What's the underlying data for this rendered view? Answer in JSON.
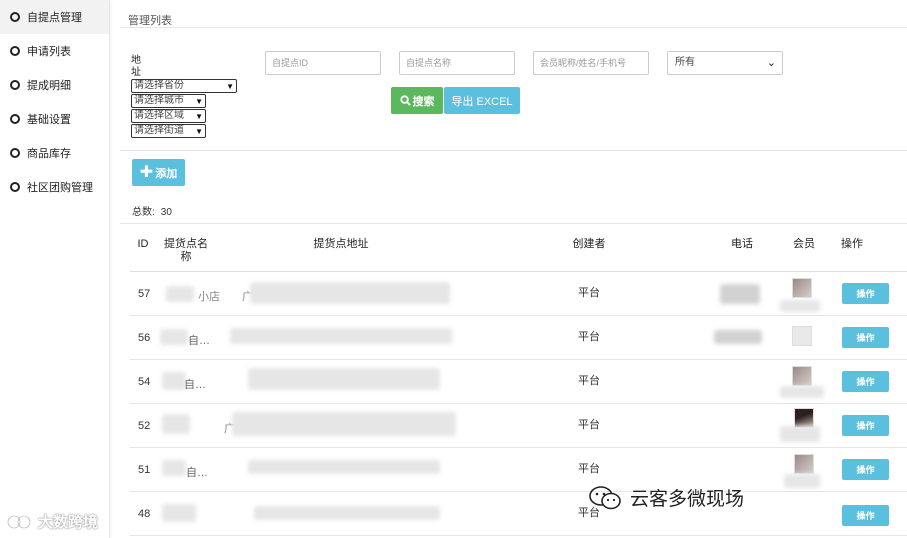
{
  "sidebar": {
    "items": [
      {
        "label": "自提点管理",
        "active": true
      },
      {
        "label": "申请列表"
      },
      {
        "label": "提成明细"
      },
      {
        "label": "基础设置"
      },
      {
        "label": "商品库存"
      },
      {
        "label": "社区团购管理"
      }
    ],
    "watermark": "大数跨境"
  },
  "page": {
    "title": "管理列表"
  },
  "filters": {
    "address_label": "地址",
    "province": "请选择省份",
    "city": "请选择城市",
    "district": "请选择区域",
    "street": "请选择街道",
    "id_placeholder": "自提点ID",
    "name_placeholder": "自提点名称",
    "member_placeholder": "会员昵称/姓名/手机号",
    "status_value": "所有",
    "search_label": "搜索",
    "export_label": "导出 EXCEL"
  },
  "toolbar": {
    "add_label": "添加",
    "total_label": "总数:",
    "total_value": "30"
  },
  "table": {
    "headers": [
      "ID",
      "提货点名称",
      "提货点地址",
      "创建者",
      "电话",
      "会员",
      "操作"
    ],
    "rows": [
      {
        "id": "57",
        "name": "小店",
        "address": "广",
        "creator": "平台",
        "action": "操作"
      },
      {
        "id": "56",
        "name": "自…",
        "address": "",
        "creator": "平台",
        "action": "操作"
      },
      {
        "id": "54",
        "name": "自…",
        "address": "",
        "creator": "平台",
        "action": "操作"
      },
      {
        "id": "52",
        "name": "",
        "address": "广",
        "creator": "平台",
        "action": "操作"
      },
      {
        "id": "51",
        "name": "自…",
        "address": "",
        "creator": "平台",
        "action": "操作"
      },
      {
        "id": "48",
        "name": "",
        "address": "",
        "creator": "平台",
        "action": "操作"
      }
    ]
  },
  "watermark_right": "云客多微现场",
  "colors": {
    "search": "#5cb85c",
    "info": "#5bc0de"
  }
}
